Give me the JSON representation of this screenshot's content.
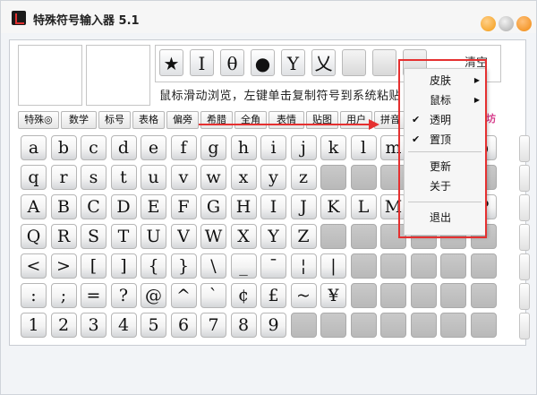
{
  "window": {
    "title": "特殊符号输入器 5.1"
  },
  "recent": {
    "symbols": [
      "★",
      "I",
      "θ",
      "●",
      "Y",
      "乂",
      "",
      "",
      "",
      ""
    ],
    "clear_label": "清空"
  },
  "hint": "鼠标滑动浏览，左键单击复制符号到系统粘贴",
  "tabs": [
    "特殊◎",
    "数学",
    "标号",
    "表格",
    "偏旁",
    "希腊",
    "全角",
    "表情",
    "贴图",
    "用户",
    "拼音"
  ],
  "logo_text": "器坊",
  "grid": {
    "rows": [
      [
        "a",
        "b",
        "c",
        "d",
        "e",
        "f",
        "g",
        "h",
        "i",
        "j",
        "k",
        "l",
        "m",
        "n",
        "o",
        "p"
      ],
      [
        "q",
        "r",
        "s",
        "t",
        "u",
        "v",
        "w",
        "x",
        "y",
        "z",
        "",
        "",
        "",
        "",
        "",
        ""
      ],
      [
        "A",
        "B",
        "C",
        "D",
        "E",
        "F",
        "G",
        "H",
        "I",
        "J",
        "K",
        "L",
        "M",
        "N",
        "O",
        "P"
      ],
      [
        "Q",
        "R",
        "S",
        "T",
        "U",
        "V",
        "W",
        "X",
        "Y",
        "Z",
        "",
        "",
        "",
        "",
        "",
        ""
      ],
      [
        "<",
        ">",
        "[",
        "]",
        "{",
        "}",
        "\\",
        "_",
        "¯",
        "¦",
        "|",
        "",
        "",
        "",
        "",
        ""
      ],
      [
        ":",
        ";",
        "=",
        "?",
        "@",
        "^",
        "`",
        "¢",
        "£",
        "~",
        "¥",
        "",
        "",
        "",
        "",
        ""
      ],
      [
        "1",
        "2",
        "3",
        "4",
        "5",
        "6",
        "7",
        "8",
        "9",
        "",
        "",
        "",
        "",
        "",
        "",
        ""
      ]
    ]
  },
  "menu": {
    "items": [
      {
        "label": "皮肤",
        "check": "",
        "submenu": "▶"
      },
      {
        "label": "鼠标",
        "check": "",
        "submenu": "▶"
      },
      {
        "label": "透明",
        "check": "✔",
        "submenu": ""
      },
      {
        "label": "置顶",
        "check": "✔",
        "submenu": ""
      },
      {
        "label": "更新",
        "check": "",
        "submenu": ""
      },
      {
        "label": "关于",
        "check": "",
        "submenu": ""
      },
      {
        "label": "退出",
        "check": "",
        "submenu": ""
      }
    ]
  },
  "colors": {
    "accent_red": "#e53030",
    "title_text": "#222222"
  }
}
